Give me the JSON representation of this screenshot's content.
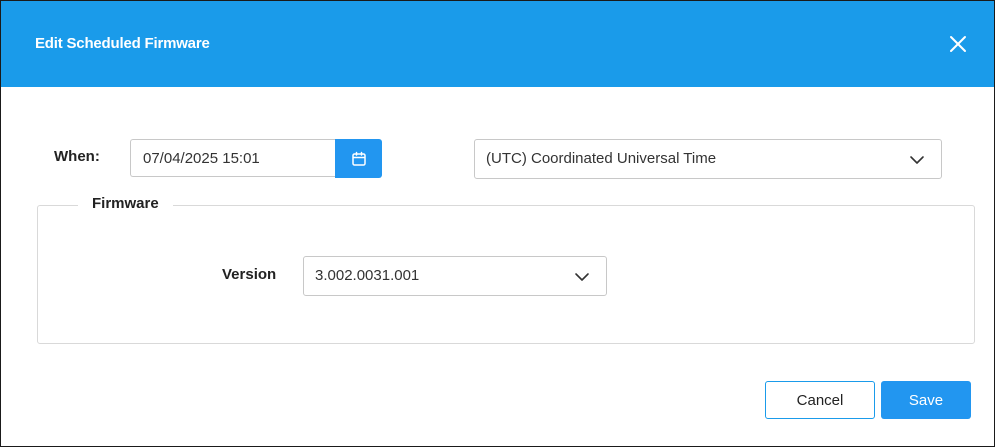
{
  "dialog": {
    "title": "Edit Scheduled Firmware",
    "header_color": "#1a9bea",
    "accent_color": "#2296f0"
  },
  "icons": {
    "close": "close-icon",
    "calendar": "calendar-icon",
    "dropdown": "chevron-down-icon"
  },
  "when": {
    "label": "When:",
    "date_value": "07/04/2025 15:01",
    "timezone_value": "(UTC) Coordinated Universal Time"
  },
  "firmware": {
    "legend": "Firmware",
    "version_label": "Version",
    "version_value": "3.002.0031.001"
  },
  "footer": {
    "cancel_label": "Cancel",
    "save_label": "Save"
  }
}
